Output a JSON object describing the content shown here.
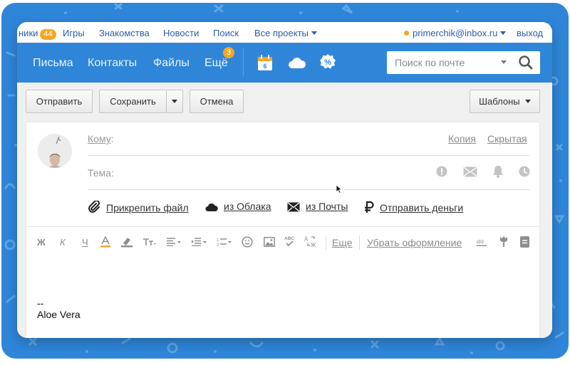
{
  "portal": {
    "items": [
      {
        "label": "ники",
        "badge": "44"
      },
      {
        "label": "Игры"
      },
      {
        "label": "Знакомства"
      },
      {
        "label": "Новости"
      },
      {
        "label": "Поиск"
      },
      {
        "label": "Все проекты"
      }
    ],
    "account": "primerchik@inbox.ru",
    "logout": "выход"
  },
  "nav": {
    "items": [
      "Письма",
      "Контакты",
      "Файлы",
      "Ещё"
    ],
    "more_badge": "3",
    "calendar_day": "6",
    "search_placeholder": "Поиск по почте"
  },
  "toolbar": {
    "send": "Отправить",
    "save": "Сохранить",
    "cancel": "Отмена",
    "templates": "Шаблоны"
  },
  "compose": {
    "to_label": "Кому",
    "to_colon": ":",
    "cc": "Копия",
    "bcc": "Скрытая",
    "subject_label": "Тема:",
    "attach": {
      "file": "Прикрепить файл",
      "cloud": "из Облака",
      "mail": "из Почты",
      "money": "Отправить деньги"
    },
    "format": {
      "bold": "Ж",
      "italic": "К",
      "underline": "Ч",
      "more": "Еще",
      "clear": "Убрать оформление"
    },
    "signature": [
      "--",
      "Aloe Vera"
    ]
  },
  "colors": {
    "accent": "#2f86d9",
    "badge": "#f5a623"
  }
}
